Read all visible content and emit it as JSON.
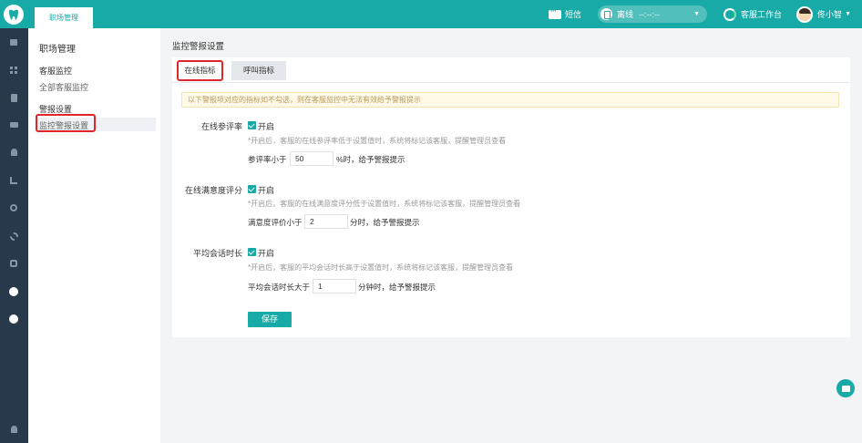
{
  "topbar": {
    "tab_label": "职场管理",
    "sms_label": "短信",
    "status": {
      "label": "离线",
      "time": "--:--:--"
    },
    "workspace_label": "客服工作台",
    "user_name": "佟小智"
  },
  "sidebar": {
    "title": "职场管理",
    "groups": [
      {
        "title": "客服监控",
        "items": [
          {
            "label": "全部客服监控"
          }
        ]
      },
      {
        "title": "警报设置",
        "items": [
          {
            "label": "监控警报设置"
          }
        ]
      }
    ]
  },
  "main": {
    "title": "监控警报设置",
    "tabs": [
      {
        "label": "在线指标"
      },
      {
        "label": "呼叫指标"
      }
    ],
    "notice": "以下警报项对应的指标如不勾选，则在客服监控中无法有效给予警报提示",
    "settings": [
      {
        "label": "在线参评率",
        "enabled_label": "开启",
        "hint": "*开启后，客服的在线参评率低于设置值时，系统将标记该客服，提醒管理员查看",
        "prefix": "参评率小于",
        "value": "50",
        "suffix": "%时，给予警报提示"
      },
      {
        "label": "在线满意度评分",
        "enabled_label": "开启",
        "hint": "*开启后，客服的在线满意度评分低于设置值时，系统将标记该客服，提醒管理员查看",
        "prefix": "满意度评价小于",
        "value": "2",
        "suffix": "分时，给予警报提示"
      },
      {
        "label": "平均会话时长",
        "enabled_label": "开启",
        "hint": "*开启后，客服的平均会话时长高于设置值时，系统将标记该客服，提醒管理员查看",
        "prefix": "平均会话时长大于",
        "value": "1",
        "suffix": "分钟时，给予警报提示"
      }
    ],
    "save_label": "保存"
  },
  "colors": {
    "brand": "#17aaa6",
    "rail": "#28394c",
    "highlight": "#e0262a"
  }
}
